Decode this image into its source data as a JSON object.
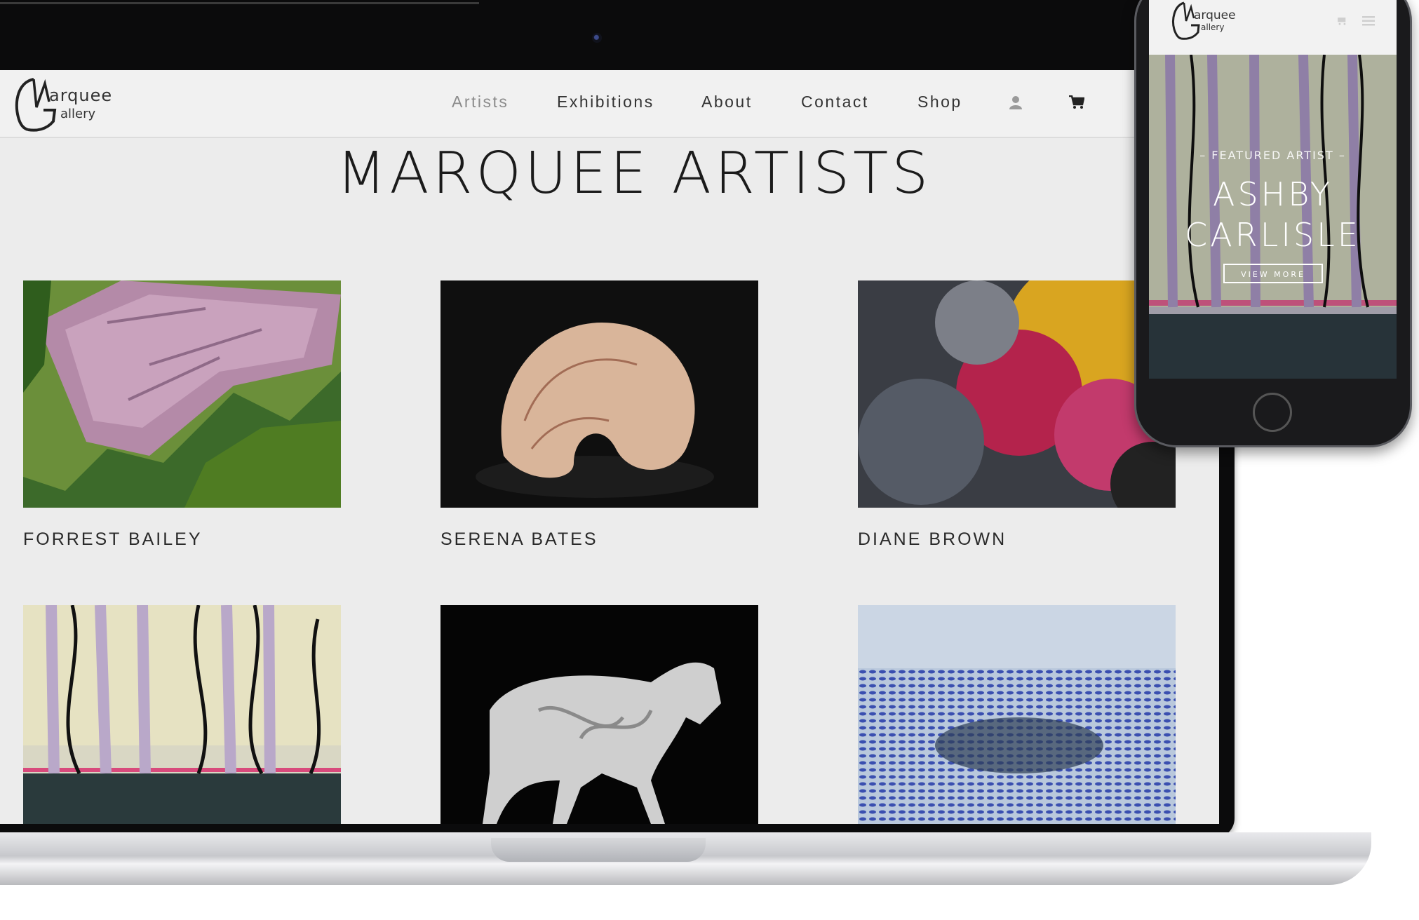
{
  "laptop": {
    "nav": {
      "logo_word1": "arquee",
      "logo_word2": "allery",
      "items": [
        "Artists",
        "Exhibitions",
        "About",
        "Contact",
        "Shop"
      ],
      "active": "Artists",
      "icons": [
        "user-icon",
        "cart-icon"
      ]
    },
    "page_title": "MARQUEE ARTISTS",
    "artists": [
      {
        "name": "FORREST BAILEY"
      },
      {
        "name": "SERENA BATES"
      },
      {
        "name": "DIANE BROWN"
      },
      {
        "name": ""
      },
      {
        "name": ""
      },
      {
        "name": ""
      }
    ]
  },
  "phone": {
    "logo_word1": "arquee",
    "logo_word2": "allery",
    "icons": [
      "cart-icon",
      "hamburger-menu-icon"
    ],
    "hero": {
      "eyebrow": "– FEATURED ARTIST –",
      "name_line1": "ASHBY",
      "name_line2": "CARLISLE",
      "button": "VIEW MORE"
    }
  },
  "colors": {
    "page_bg": "#ececec",
    "nav_active": "#8c8c8c",
    "text": "#2a2a2a"
  }
}
